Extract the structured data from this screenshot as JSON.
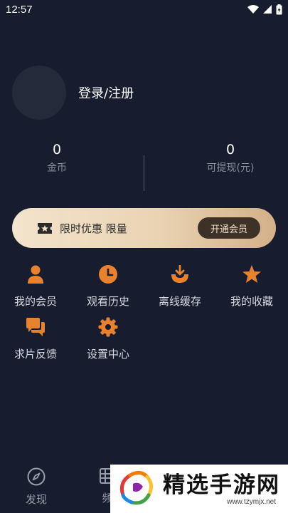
{
  "status_bar": {
    "time": "12:57"
  },
  "profile": {
    "login_label": "登录/注册"
  },
  "stats": [
    {
      "value": "0",
      "label": "金币"
    },
    {
      "value": "0",
      "label": "可提现(元)"
    }
  ],
  "vip_banner": {
    "text": "限时优惠 限量",
    "button_label": "开通会员"
  },
  "menu": [
    {
      "label": "我的会员",
      "icon": "user-icon"
    },
    {
      "label": "观看历史",
      "icon": "clock-icon"
    },
    {
      "label": "离线缓存",
      "icon": "download-icon"
    },
    {
      "label": "我的收藏",
      "icon": "star-icon"
    },
    {
      "label": "求片反馈",
      "icon": "chat-icon"
    },
    {
      "label": "设置中心",
      "icon": "gear-icon"
    }
  ],
  "tabbar": [
    {
      "label": "发现",
      "icon": "compass-icon"
    },
    {
      "label": "频",
      "icon": "grid-icon"
    }
  ],
  "watermark": {
    "title": "精选手游网",
    "url": "www.tzymjx.net"
  },
  "colors": {
    "background": "#171c2e",
    "accent": "#e8822e",
    "vip_gold": "#ead3b3"
  }
}
